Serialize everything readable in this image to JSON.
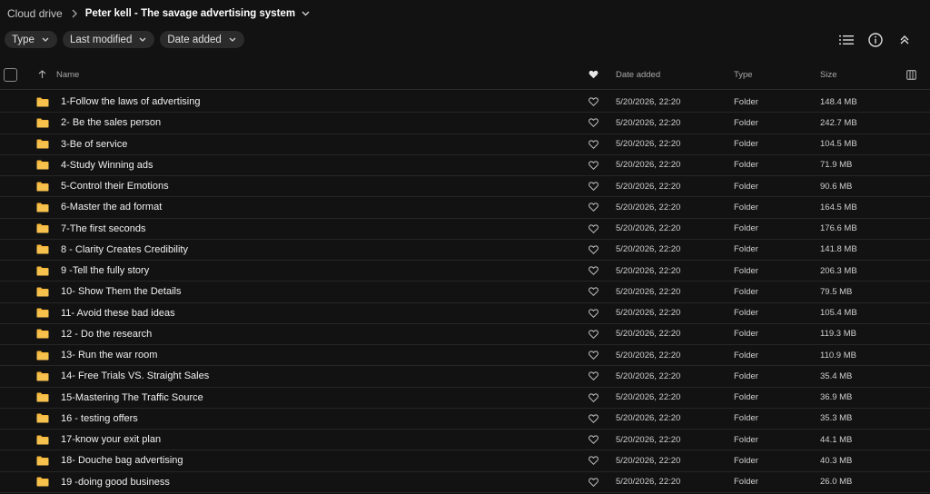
{
  "breadcrumb": {
    "root": "Cloud drive",
    "current": "Peter kell - The savage advertising system"
  },
  "filters": [
    {
      "label": "Type"
    },
    {
      "label": "Last modified"
    },
    {
      "label": "Date added"
    }
  ],
  "toolbar": {
    "list_view_icon": "list-view-icon",
    "info_icon": "info-icon",
    "collapse_icon": "collapse-icon"
  },
  "table": {
    "columns": {
      "name": "Name",
      "date_added": "Date added",
      "type": "Type",
      "size": "Size"
    },
    "rows": [
      {
        "name": "1-Follow the laws of advertising",
        "date": "5/20/2026, 22:20",
        "type": "Folder",
        "size": "148.4 MB"
      },
      {
        "name": "2- Be the sales person",
        "date": "5/20/2026, 22:20",
        "type": "Folder",
        "size": "242.7 MB"
      },
      {
        "name": "3-Be of service",
        "date": "5/20/2026, 22:20",
        "type": "Folder",
        "size": "104.5 MB"
      },
      {
        "name": "4-Study Winning ads",
        "date": "5/20/2026, 22:20",
        "type": "Folder",
        "size": "71.9 MB"
      },
      {
        "name": "5-Control their Emotions",
        "date": "5/20/2026, 22:20",
        "type": "Folder",
        "size": "90.6 MB"
      },
      {
        "name": "6-Master the ad format",
        "date": "5/20/2026, 22:20",
        "type": "Folder",
        "size": "164.5 MB"
      },
      {
        "name": "7-The first seconds",
        "date": "5/20/2026, 22:20",
        "type": "Folder",
        "size": "176.6 MB"
      },
      {
        "name": "8 - Clarity Creates Credibility",
        "date": "5/20/2026, 22:20",
        "type": "Folder",
        "size": "141.8 MB"
      },
      {
        "name": "9 -Tell the fully story",
        "date": "5/20/2026, 22:20",
        "type": "Folder",
        "size": "206.3 MB"
      },
      {
        "name": "10- Show Them the Details",
        "date": "5/20/2026, 22:20",
        "type": "Folder",
        "size": "79.5 MB"
      },
      {
        "name": "11- Avoid these bad ideas",
        "date": "5/20/2026, 22:20",
        "type": "Folder",
        "size": "105.4 MB"
      },
      {
        "name": "12 - Do the research",
        "date": "5/20/2026, 22:20",
        "type": "Folder",
        "size": "119.3 MB"
      },
      {
        "name": "13- Run the war room",
        "date": "5/20/2026, 22:20",
        "type": "Folder",
        "size": "110.9 MB"
      },
      {
        "name": "14- Free Trials VS. Straight Sales",
        "date": "5/20/2026, 22:20",
        "type": "Folder",
        "size": "35.4 MB"
      },
      {
        "name": "15-Mastering The Traffic Source",
        "date": "5/20/2026, 22:20",
        "type": "Folder",
        "size": "36.9 MB"
      },
      {
        "name": "16 - testing offers",
        "date": "5/20/2026, 22:20",
        "type": "Folder",
        "size": "35.3 MB"
      },
      {
        "name": "17-know your exit plan",
        "date": "5/20/2026, 22:20",
        "type": "Folder",
        "size": "44.1 MB"
      },
      {
        "name": "18- Douche bag advertising",
        "date": "5/20/2026, 22:20",
        "type": "Folder",
        "size": "40.3 MB"
      },
      {
        "name": "19 -doing good business",
        "date": "5/20/2026, 22:20",
        "type": "Folder",
        "size": "26.0 MB"
      }
    ]
  },
  "colors": {
    "background": "#121212",
    "chip": "#2b2b2b",
    "folder": "#f5b63a",
    "divider": "#262626"
  }
}
